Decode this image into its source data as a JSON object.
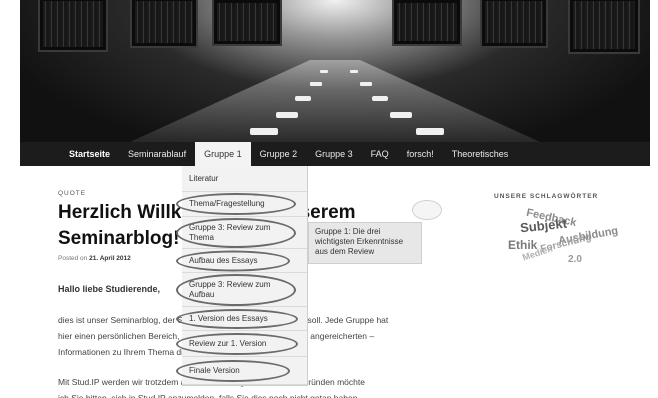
{
  "nav": {
    "items": [
      "Startseite",
      "Seminarablauf",
      "Gruppe 1",
      "Gruppe 2",
      "Gruppe 3",
      "FAQ",
      "forsch!",
      "Theoretisches"
    ],
    "active_index": 2
  },
  "dropdown": {
    "items": [
      "Literatur",
      "Thema/Fragestellung",
      "Gruppe 3: Review zum Thema",
      "Aufbau des Essays",
      "Gruppe 3: Review zum Aufbau",
      "1. Version des Essays",
      "Review zur 1. Version",
      "Finale Version"
    ]
  },
  "flyout": {
    "text": "Gruppe 1: Die drei wichtigsten Erkenntnisse aus dem Review"
  },
  "post": {
    "format_label": "QUOTE",
    "title_line1": "Herzlich Willkommen in unserem",
    "title_line2": "Seminarblog!",
    "posted_prefix": "Posted on",
    "posted_date": "21. April 2012",
    "greeting": "Hallo liebe Studierende,",
    "paragraph1": [
      "dies ist unser Seminarblog, der Sie durch das Semester begleiten soll. Jede Gruppe hat",
      "hier einen persönlichen Bereich, der zur Darstellung des Seminars angereicherten –",
      "Informationen zu Ihrem Thema dient."
    ],
    "paragraph2": [
      "Mit Stud.IP werden wir trotzdem arbeiten, aus organisatorischen Gründen möchte",
      "ich Sie bitten, sich in Stud.IP anzumelden, falls Sie dies noch nicht getan haben."
    ]
  },
  "sidebar": {
    "title": "UNSERE SCHLAGWÖRTER",
    "tags": [
      "Feedback",
      "Subjekt",
      "Ausbildung",
      "Ethik",
      "Forschung",
      "Medien",
      "2.0"
    ]
  }
}
